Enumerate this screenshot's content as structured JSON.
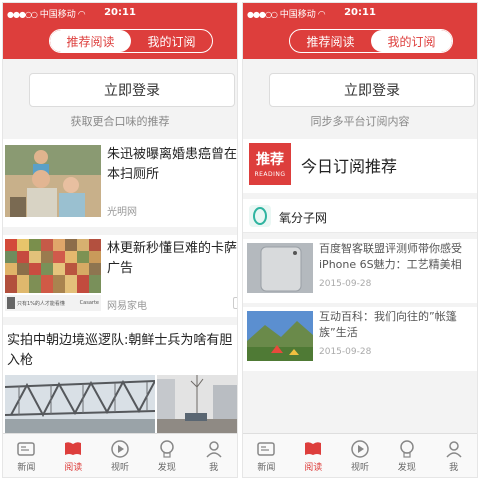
{
  "status_bar": {
    "signal": "●●●○○",
    "carrier": "中国移动",
    "time": "20:11"
  },
  "tabs": {
    "recommended": "推荐阅读",
    "subscriptions": "我的订阅"
  },
  "left": {
    "login_label": "立即登录",
    "login_hint": "获取更合口味的推荐",
    "news": [
      {
        "title": "朱迅被曝离婚患癌曾在本扫厕所",
        "source": "光明网"
      },
      {
        "title": "林更新秒懂巨难的卡萨广告",
        "source": "网易家电",
        "ad_labels": [
          "只有1%的人才能看懂",
          "Casarte"
        ]
      },
      {
        "title": "实拍中朝边境巡逻队:朝鲜士兵为啥有胆入枪"
      }
    ]
  },
  "right": {
    "login_label": "立即登录",
    "login_hint": "同步多平台订阅内容",
    "recommend_badge": "推荐",
    "recommend_badge_sub": "READING",
    "recommend_title": "今日订阅推荐",
    "source_name": "氧分子网",
    "items": [
      {
        "title": "百度智客联盟评测师带你感受iPhone 6S魅力：工艺精美相",
        "date": "2015-09-28"
      },
      {
        "title": "互动百科：我们向往的”帐篷族”生活",
        "date": "2015-09-28"
      }
    ]
  },
  "tab_bar": [
    {
      "label": "新闻",
      "icon": "news-icon"
    },
    {
      "label": "阅读",
      "icon": "book-icon"
    },
    {
      "label": "视听",
      "icon": "play-icon"
    },
    {
      "label": "发现",
      "icon": "bulb-icon"
    },
    {
      "label": "我",
      "icon": "user-icon"
    }
  ],
  "colors": {
    "brand": "#dd3e3c",
    "background": "#f3f3f3"
  }
}
